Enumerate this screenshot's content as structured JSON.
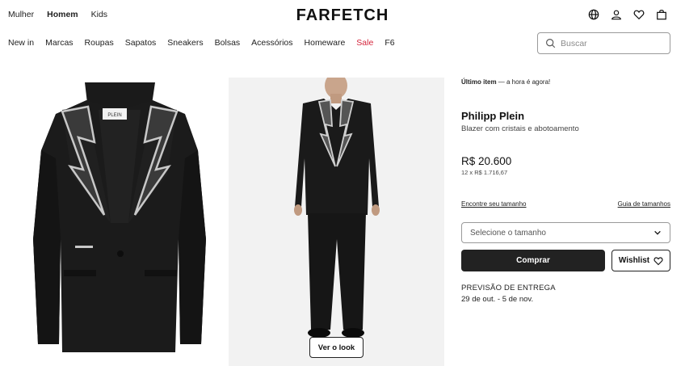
{
  "header": {
    "logo": "FARFETCH",
    "gender_tabs": [
      {
        "label": "Mulher",
        "active": false
      },
      {
        "label": "Homem",
        "active": true
      },
      {
        "label": "Kids",
        "active": false
      }
    ],
    "icons": [
      "globe-icon",
      "account-icon",
      "wishlist-heart-icon",
      "bag-icon"
    ]
  },
  "nav": {
    "categories": [
      "New in",
      "Marcas",
      "Roupas",
      "Sapatos",
      "Sneakers",
      "Bolsas",
      "Acessórios",
      "Homeware",
      "Sale",
      "F6"
    ],
    "sale_color": "#d4243b"
  },
  "search": {
    "placeholder": "Buscar"
  },
  "gallery": {
    "look_button": "Ver o look",
    "label_tag": "PLEIN"
  },
  "product": {
    "stock_label": "Último item",
    "stock_note": " — a hora é agora!",
    "brand": "Philipp Plein",
    "description": "Blazer com cristais e abotoamento",
    "price": "R$ 20.600",
    "installments": "12 x R$ 1.716,67",
    "size_link": "Encontre seu tamanho",
    "guide_link": "Guia de tamanhos",
    "size_placeholder": "Selecione o tamanho",
    "buy_label": "Comprar",
    "wishlist_label": "Wishlist",
    "delivery_label": "PREVISÃO DE ENTREGA",
    "delivery_date": "29 de out. - 5 de nov."
  },
  "colors": {
    "primary": "#222222",
    "sale": "#d4243b",
    "gallery_bg": "#f2f2f2"
  }
}
